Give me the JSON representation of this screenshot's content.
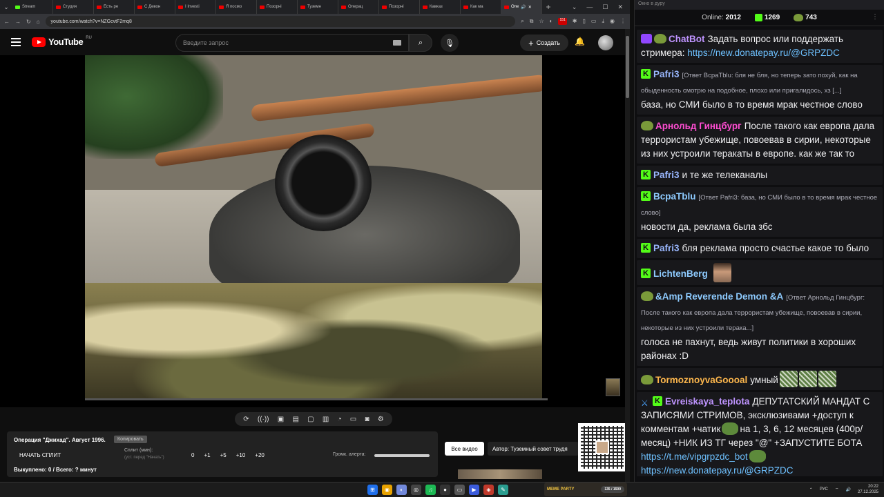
{
  "browser": {
    "tabs": [
      {
        "label": "Stream",
        "favicon": "kick"
      },
      {
        "label": "Студия",
        "favicon": "youtube"
      },
      {
        "label": "Есть ре",
        "favicon": "youtube"
      },
      {
        "label": "С Девон",
        "favicon": "youtube"
      },
      {
        "label": "I Investi",
        "favicon": "youtube"
      },
      {
        "label": "Я посмо",
        "favicon": "youtube"
      },
      {
        "label": "Позорні",
        "favicon": "youtube"
      },
      {
        "label": "Туземн",
        "favicon": "youtube"
      },
      {
        "label": "Операц",
        "favicon": "youtube"
      },
      {
        "label": "Позорні",
        "favicon": "youtube"
      },
      {
        "label": "Кавказ",
        "favicon": "youtube"
      },
      {
        "label": "Как ма",
        "favicon": "youtube"
      },
      {
        "label": "Опе",
        "favicon": "youtube",
        "active": true
      }
    ],
    "url": "youtube.com/watch?v=NZGcvtF2mq8",
    "extension_badge": "151"
  },
  "youtube": {
    "logo_text": "YouTube",
    "logo_region": "RU",
    "search_placeholder": "Введите запрос",
    "create_label": "Создать"
  },
  "panel": {
    "video_title": "Операция \"Джихад\". Август 1996.",
    "copy_label": "Копировать",
    "split_button": "НАЧАТЬ СПЛИТ",
    "split_label": "Сплит (мин):",
    "split_hint": "(уст. перед \"Начать\")",
    "split_values": [
      "0",
      "+1",
      "+5",
      "+10",
      "+20"
    ],
    "volume_label": "Громк. алерта:",
    "bought": "Выкуплено: 0 / Всего: ? минут",
    "all_video": "Все видео",
    "author": "Автор: Туземный совет трудя"
  },
  "chat": {
    "window_title": "Окно в дуру",
    "online_label": "Online:",
    "online_count": "2012",
    "kick_count": "1269",
    "other_count": "743",
    "messages": [
      {
        "badges": [
          "bot",
          "frog"
        ],
        "user": "ChatBot",
        "color": "#bf94ff",
        "text": "Задать вопрос или поддержать стримера: ",
        "link": "https://new.donatepay.ru/@GRPZDC"
      },
      {
        "badges": [
          "kick"
        ],
        "user": "Pafri3",
        "color": "#9ab8ff",
        "reply": "[Ответ BcpaTblu: бля не бля, но теперь зато похуй, как на обыденность смотрю на подобное, плохо или пригалидось, хз [...]",
        "text": "база, но СМИ было в то время мрак честное слово"
      },
      {
        "badges": [
          "frog"
        ],
        "user": "Арнольд Гинцбург",
        "color": "#ff4dd2",
        "text": "После такого как европа дала террористам убежище, повоевав в сирии, некоторые из них устроили теракаты в европе. как же так то"
      },
      {
        "badges": [
          "kick"
        ],
        "user": "Pafri3",
        "color": "#9ab8ff",
        "text": "и те же телеканалы"
      },
      {
        "badges": [
          "kick"
        ],
        "user": "BcpaTblu",
        "color": "#8ecbff",
        "reply": "[Ответ Pafri3: база, но СМИ было в то время мрак честное слово]",
        "text": "новости да, реклама была збс"
      },
      {
        "badges": [
          "kick"
        ],
        "user": "Pafri3",
        "color": "#9ab8ff",
        "text": "бля реклама просто счастье какое то было"
      },
      {
        "badges": [
          "kick"
        ],
        "user": "LichtenBerg",
        "color": "#8ecbff",
        "text": "",
        "face": true
      },
      {
        "badges": [
          "frog"
        ],
        "user": "&Amp Reverende Demon &A",
        "color": "#8ecbff",
        "reply": "[Ответ Арнольд Гинцбург: После такого как европа дала террористам убежище, повоевав в сирии, некоторые из них устроили терака...]",
        "text": "голоса не пахнут, ведь живут политики в хороших районах :D"
      },
      {
        "badges": [
          "frog"
        ],
        "user": "TormoznoyvaGoooal",
        "color": "#ffb84d",
        "text": "умный",
        "emotes": 3
      },
      {
        "badges": [
          "sword",
          "kick"
        ],
        "user": "Evreiskaya_teplota",
        "color": "#bf94ff",
        "text": "ДЕПУТАТСКИЙ МАНДАТ С ЗАПИСЯМИ СТРИМОВ, эксклюзивами +доступ к комментам +чатик",
        "text2": "на 1, 3, 6, 12 месяцев (400р/месяц) +НИК ИЗ ТГ через \"@\" +ЗАПУСТИТЕ БОТА",
        "link": "https://t.me/vipgrpzdc_bot",
        "link2": "https://new.donatepay.ru/@GRPZDC"
      }
    ]
  },
  "taskbar": {
    "meme_label": "MEME PARTY",
    "meme_progress": "135 / 1500",
    "lang": "РУС",
    "time": "20:22",
    "date": "27.12.2025"
  }
}
